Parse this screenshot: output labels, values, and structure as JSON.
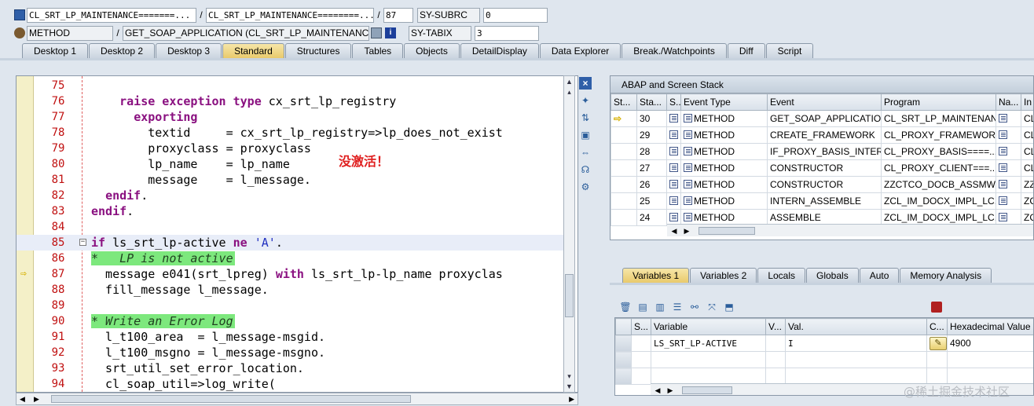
{
  "header": {
    "row1": {
      "class_field": "CL_SRT_LP_MAINTENANCE=======...",
      "program_field": "CL_SRT_LP_MAINTENANCE========...",
      "line_field": "87",
      "sysvar_name": "SY-SUBRC",
      "sysvar_value": "0"
    },
    "row2": {
      "type_field": "METHOD",
      "event_field": "GET_SOAP_APPLICATION (CL_SRT_LP_MAINTENANCE)",
      "sysvar_name": "SY-TABIX",
      "sysvar_value": "3"
    }
  },
  "tabs": [
    "Desktop 1",
    "Desktop 2",
    "Desktop 3",
    "Standard",
    "Structures",
    "Tables",
    "Objects",
    "DetailDisplay",
    "Data Explorer",
    "Break./Watchpoints",
    "Diff",
    "Script"
  ],
  "active_tab": "Standard",
  "code": [
    {
      "ln": "75",
      "html": ""
    },
    {
      "ln": "76",
      "html": "    <span class=\"kw\">raise exception type</span> cx_srt_lp_registry"
    },
    {
      "ln": "77",
      "html": "      <span class=\"kw\">exporting</span>"
    },
    {
      "ln": "78",
      "html": "        textid     = cx_srt_lp_registry=>lp_does_not_exist"
    },
    {
      "ln": "79",
      "html": "        proxyclass = proxyclass"
    },
    {
      "ln": "80",
      "html": "        lp_name    = lp_name"
    },
    {
      "ln": "81",
      "html": "        message    = l_message."
    },
    {
      "ln": "82",
      "html": "  <span class=\"kw\">endif</span>."
    },
    {
      "ln": "83",
      "html": "<span class=\"kw\">endif</span>."
    },
    {
      "ln": "84",
      "html": ""
    },
    {
      "ln": "85",
      "html": "<span class=\"kw\">if</span> ls_srt_lp-active <span class=\"kw\">ne</span> <span class=\"str\">'A'</span>."
    },
    {
      "ln": "86",
      "html": "<span class=\"cmt-bg\">*   LP is not active</span>"
    },
    {
      "ln": "87",
      "html": "  message e041(srt_lpreg) <span class=\"kw\">with</span> ls_srt_lp-lp_name proxyclas"
    },
    {
      "ln": "88",
      "html": "  fill_message l_message."
    },
    {
      "ln": "89",
      "html": ""
    },
    {
      "ln": "90",
      "html": "<span class=\"cmt-bg\">* Write an Error Log</span>"
    },
    {
      "ln": "91",
      "html": "  l_t100_area  = l_message-msgid."
    },
    {
      "ln": "92",
      "html": "  l_t100_msgno = l_message-msgno."
    },
    {
      "ln": "93",
      "html": "  srt_util_set_error_location."
    },
    {
      "ln": "94",
      "html": "  cl_soap_util=>log_write("
    }
  ],
  "annotation": "没激活！",
  "stack": {
    "title": "ABAP and Screen Stack",
    "columns": [
      "St...",
      "Sta...",
      "S...",
      "Event Type",
      "Event",
      "Program",
      "Na...",
      "In"
    ],
    "rows": [
      [
        "",
        "30",
        "",
        "METHOD",
        "GET_SOAP_APPLICATION",
        "CL_SRT_LP_MAINTENAN...",
        "",
        "CL"
      ],
      [
        "",
        "29",
        "",
        "METHOD",
        "CREATE_FRAMEWORK",
        "CL_PROXY_FRAMEWORK...",
        "",
        "CL"
      ],
      [
        "",
        "28",
        "",
        "METHOD",
        "IF_PROXY_BASIS_INTER...",
        "CL_PROXY_BASIS====...",
        "",
        "CL"
      ],
      [
        "",
        "27",
        "",
        "METHOD",
        "CONSTRUCTOR",
        "CL_PROXY_CLIENT===...",
        "",
        "CL"
      ],
      [
        "",
        "26",
        "",
        "METHOD",
        "CONSTRUCTOR",
        "ZZCTCO_DOCB_ASSMW...",
        "",
        "ZZ"
      ],
      [
        "",
        "25",
        "",
        "METHOD",
        "INTERN_ASSEMBLE",
        "ZCL_IM_DOCX_IMPL_LC...",
        "",
        "ZC"
      ],
      [
        "",
        "24",
        "",
        "METHOD",
        "ASSEMBLE",
        "ZCL_IM_DOCX_IMPL_LC...",
        "",
        "ZC"
      ]
    ]
  },
  "var_tabs": [
    "Variables 1",
    "Variables 2",
    "Locals",
    "Globals",
    "Auto",
    "Memory Analysis"
  ],
  "vars": {
    "columns": [
      "S...",
      "Variable",
      "V...",
      "Val.",
      "C...",
      "Hexadecimal Value"
    ],
    "row": {
      "variable": "LS_SRT_LP-ACTIVE",
      "value": "I",
      "hex": "4900"
    }
  },
  "watermark": "@稀土掘金技术社区"
}
